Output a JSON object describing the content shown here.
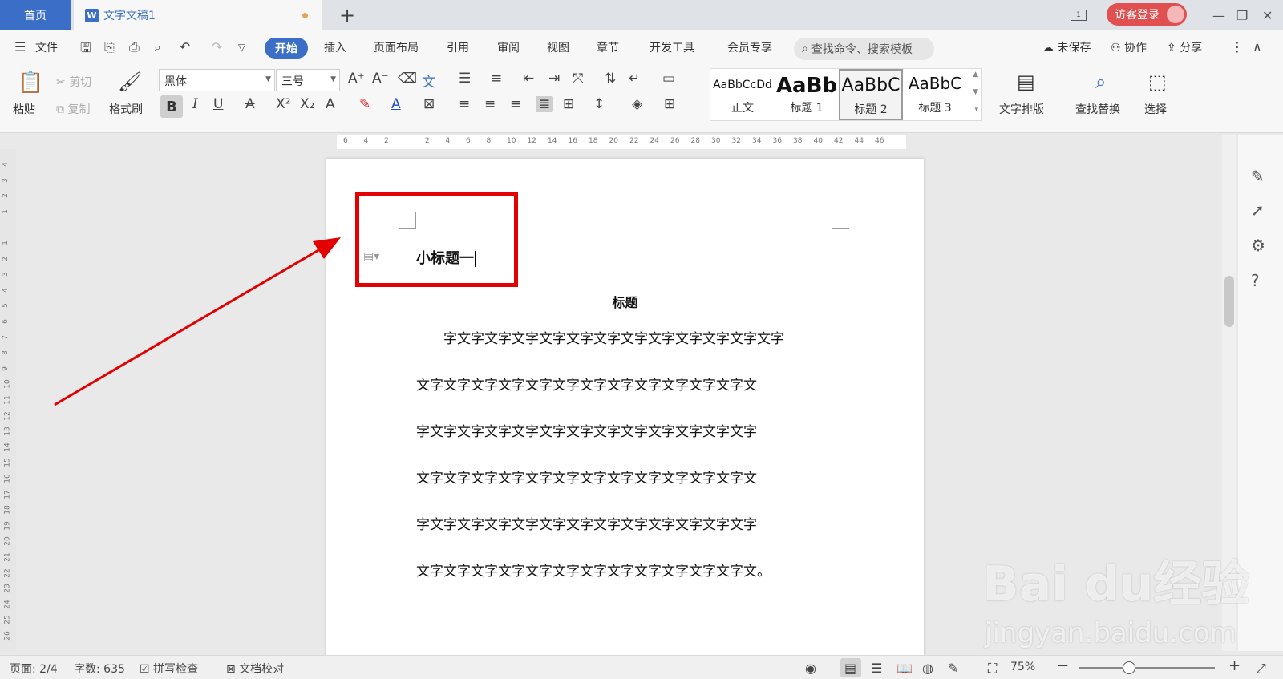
{
  "tabs": {
    "home": "首页",
    "doc_title": "文字文稿1",
    "add": "+"
  },
  "window": {
    "login": "访客登录"
  },
  "menu": {
    "file": "文件",
    "start": "开始",
    "insert": "插入",
    "layout": "页面布局",
    "reference": "引用",
    "review": "审阅",
    "view": "视图",
    "chapter": "章节",
    "devtools": "开发工具",
    "vip": "会员专享",
    "search_placeholder": "查找命令、搜索模板",
    "unsaved": "未保存",
    "collab": "协作",
    "share": "分享"
  },
  "ribbon": {
    "paste": "粘贴",
    "cut": "剪切",
    "copy": "复制",
    "format_painter": "格式刷",
    "font_name": "黑体",
    "font_size": "三号",
    "styles": [
      {
        "sample": "AaBbCcDd",
        "name": "正文"
      },
      {
        "sample": "AaBb",
        "name": "标题 1"
      },
      {
        "sample": "AaBbC",
        "name": "标题 2"
      },
      {
        "sample": "AaBbC",
        "name": "标题 3"
      }
    ],
    "text_layout": "文字排版",
    "find_replace": "查找替换",
    "select": "选择"
  },
  "ruler": {
    "h_ticks": [
      "6",
      "4",
      "2",
      "",
      "2",
      "4",
      "6",
      "8",
      "10",
      "12",
      "14",
      "16",
      "18",
      "20",
      "22",
      "24",
      "26",
      "28",
      "30",
      "32",
      "34",
      "36",
      "38",
      "40",
      "42",
      "44",
      "46"
    ],
    "v_ticks": [
      "4",
      "3",
      "2",
      "1",
      "",
      "1",
      "2",
      "3",
      "4",
      "5",
      "6",
      "7",
      "8",
      "9",
      "10",
      "11",
      "12",
      "13",
      "14",
      "15",
      "16",
      "17",
      "18",
      "19",
      "20",
      "21",
      "22",
      "23",
      "24",
      "25",
      "26"
    ]
  },
  "document": {
    "subheading": "小标题一",
    "title": "标题",
    "lines": [
      "字文字文字文字文字文字文字文字文字文字文字文字文字",
      "文字文字文字文字文字文字文字文字文字文字文字文字文",
      "字文字文字文字文字文字文字文字文字文字文字文字文字",
      "文字文字文字文字文字文字文字文字文字文字文字文字文",
      "字文字文字文字文字文字文字文字文字文字文字文字文字",
      "文字文字文字文字文字文字文字文字文字文字文字文字文。"
    ]
  },
  "status": {
    "page": "页面: 2/4",
    "word_count": "字数: 635",
    "spell_check": "拼写检查",
    "doc_proof": "文档校对",
    "zoom": "75%"
  },
  "watermark": {
    "brand": "Bai du经验",
    "site": "jingyan.baidu.com"
  },
  "colors": {
    "accent": "#3b6fc7",
    "highlight_red": "#e30000",
    "login_red": "#e05050"
  }
}
